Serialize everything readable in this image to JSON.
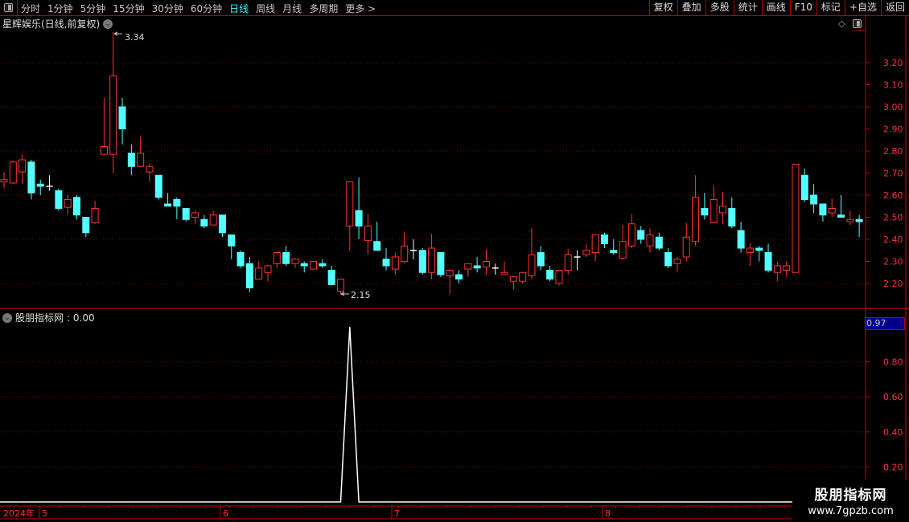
{
  "toolbar": {
    "periods": [
      "分时",
      "1分钟",
      "5分钟",
      "15分钟",
      "30分钟",
      "60分钟",
      "日线",
      "周线",
      "月线",
      "多周期",
      "更多 >"
    ],
    "active_period": "日线",
    "tools": [
      "复权",
      "叠加",
      "多股",
      "统计",
      "画线",
      "F10",
      "标记",
      "+自选",
      "返回"
    ]
  },
  "main": {
    "title": "星辉娱乐(日线,前复权)",
    "high_label": "3.34",
    "low_label": "2.15"
  },
  "indicator": {
    "title": "股朋指标网",
    "value_text": ": 0.00",
    "readout": "0.97"
  },
  "date_axis": {
    "year": "2024年",
    "months": [
      "5",
      "6",
      "7",
      "8"
    ]
  },
  "watermark": {
    "line1": "股朋指标网",
    "line2": "www.7gpzb.com"
  },
  "colors": {
    "up": "#ff3333",
    "down": "#54ffff",
    "doji": "#ffffff",
    "axis": "#cc0000",
    "grid": "#8b0000",
    "active": "#33ffff"
  },
  "chart_data": [
    {
      "type": "candlestick",
      "ylim": [
        2.1,
        3.4
      ],
      "yticks": [
        "3.20",
        "3.10",
        "3.00",
        "2.90",
        "2.80",
        "2.70",
        "2.60",
        "2.50",
        "2.40",
        "2.30",
        "2.20"
      ],
      "grid": true,
      "ohlc": [
        [
          2.66,
          2.705,
          2.63,
          2.67
        ],
        [
          2.655,
          2.756,
          2.65,
          2.75
        ],
        [
          2.705,
          2.785,
          2.65,
          2.76
        ],
        [
          2.75,
          2.76,
          2.58,
          2.61
        ],
        [
          2.65,
          2.67,
          2.6,
          2.64
        ],
        [
          2.64,
          2.69,
          2.62,
          2.64
        ],
        [
          2.62,
          2.63,
          2.53,
          2.54
        ],
        [
          2.545,
          2.6,
          2.51,
          2.58
        ],
        [
          2.59,
          2.6,
          2.49,
          2.51
        ],
        [
          2.5,
          2.5,
          2.41,
          2.43
        ],
        [
          2.475,
          2.575,
          2.47,
          2.54
        ],
        [
          2.785,
          3.04,
          2.785,
          2.82
        ],
        [
          2.785,
          3.34,
          2.7,
          3.14
        ],
        [
          3.0,
          3.04,
          2.83,
          2.9
        ],
        [
          2.79,
          2.83,
          2.69,
          2.73
        ],
        [
          2.73,
          2.865,
          2.73,
          2.79
        ],
        [
          2.705,
          2.745,
          2.66,
          2.73
        ],
        [
          2.69,
          2.69,
          2.58,
          2.59
        ],
        [
          2.56,
          2.61,
          2.55,
          2.55
        ],
        [
          2.58,
          2.59,
          2.49,
          2.55
        ],
        [
          2.54,
          2.54,
          2.48,
          2.49
        ],
        [
          2.5,
          2.53,
          2.47,
          2.52
        ],
        [
          2.49,
          2.51,
          2.45,
          2.46
        ],
        [
          2.465,
          2.53,
          2.465,
          2.51
        ],
        [
          2.51,
          2.51,
          2.41,
          2.43
        ],
        [
          2.42,
          2.42,
          2.31,
          2.37
        ],
        [
          2.34,
          2.35,
          2.27,
          2.28
        ],
        [
          2.29,
          2.32,
          2.16,
          2.18
        ],
        [
          2.22,
          2.3,
          2.22,
          2.27
        ],
        [
          2.25,
          2.285,
          2.21,
          2.28
        ],
        [
          2.29,
          2.345,
          2.27,
          2.34
        ],
        [
          2.34,
          2.37,
          2.28,
          2.29
        ],
        [
          2.29,
          2.315,
          2.27,
          2.31
        ],
        [
          2.29,
          2.3,
          2.25,
          2.28
        ],
        [
          2.265,
          2.3,
          2.265,
          2.3
        ],
        [
          2.29,
          2.31,
          2.27,
          2.28
        ],
        [
          2.26,
          2.28,
          2.195,
          2.195
        ],
        [
          2.165,
          2.22,
          2.15,
          2.22
        ],
        [
          2.46,
          2.66,
          2.35,
          2.66
        ],
        [
          2.53,
          2.68,
          2.4,
          2.46
        ],
        [
          2.395,
          2.515,
          2.33,
          2.46
        ],
        [
          2.39,
          2.48,
          2.35,
          2.35
        ],
        [
          2.31,
          2.36,
          2.26,
          2.28
        ],
        [
          2.265,
          2.34,
          2.24,
          2.32
        ],
        [
          2.3,
          2.435,
          2.29,
          2.37
        ],
        [
          2.35,
          2.4,
          2.31,
          2.35
        ],
        [
          2.35,
          2.36,
          2.24,
          2.25
        ],
        [
          2.25,
          2.425,
          2.22,
          2.36
        ],
        [
          2.34,
          2.34,
          2.23,
          2.24
        ],
        [
          2.235,
          2.26,
          2.15,
          2.26
        ],
        [
          2.24,
          2.26,
          2.2,
          2.22
        ],
        [
          2.265,
          2.29,
          2.23,
          2.29
        ],
        [
          2.28,
          2.32,
          2.25,
          2.27
        ],
        [
          2.275,
          2.355,
          2.24,
          2.3
        ],
        [
          2.27,
          2.29,
          2.24,
          2.27
        ],
        [
          2.24,
          2.3,
          2.24,
          2.25
        ],
        [
          2.21,
          2.235,
          2.17,
          2.23
        ],
        [
          2.21,
          2.25,
          2.2,
          2.25
        ],
        [
          2.235,
          2.45,
          2.22,
          2.33
        ],
        [
          2.34,
          2.37,
          2.26,
          2.28
        ],
        [
          2.26,
          2.28,
          2.21,
          2.22
        ],
        [
          2.2,
          2.26,
          2.19,
          2.26
        ],
        [
          2.26,
          2.355,
          2.24,
          2.33
        ],
        [
          2.32,
          2.35,
          2.26,
          2.32
        ],
        [
          2.33,
          2.38,
          2.32,
          2.35
        ],
        [
          2.34,
          2.42,
          2.3,
          2.42
        ],
        [
          2.42,
          2.43,
          2.36,
          2.38
        ],
        [
          2.35,
          2.4,
          2.33,
          2.34
        ],
        [
          2.315,
          2.465,
          2.31,
          2.39
        ],
        [
          2.37,
          2.515,
          2.36,
          2.47
        ],
        [
          2.44,
          2.46,
          2.38,
          2.4
        ],
        [
          2.37,
          2.45,
          2.34,
          2.42
        ],
        [
          2.41,
          2.43,
          2.35,
          2.36
        ],
        [
          2.34,
          2.36,
          2.27,
          2.28
        ],
        [
          2.29,
          2.32,
          2.25,
          2.31
        ],
        [
          2.32,
          2.475,
          2.3,
          2.41
        ],
        [
          2.39,
          2.69,
          2.37,
          2.59
        ],
        [
          2.54,
          2.61,
          2.49,
          2.51
        ],
        [
          2.475,
          2.645,
          2.475,
          2.58
        ],
        [
          2.52,
          2.615,
          2.47,
          2.55
        ],
        [
          2.54,
          2.59,
          2.45,
          2.46
        ],
        [
          2.44,
          2.48,
          2.34,
          2.36
        ],
        [
          2.34,
          2.38,
          2.28,
          2.36
        ],
        [
          2.36,
          2.37,
          2.3,
          2.35
        ],
        [
          2.34,
          2.38,
          2.25,
          2.26
        ],
        [
          2.25,
          2.3,
          2.21,
          2.28
        ],
        [
          2.26,
          2.3,
          2.23,
          2.28
        ],
        [
          2.25,
          2.74,
          2.25,
          2.74
        ],
        [
          2.69,
          2.72,
          2.57,
          2.58
        ],
        [
          2.6,
          2.65,
          2.52,
          2.56
        ],
        [
          2.56,
          2.56,
          2.48,
          2.51
        ],
        [
          2.52,
          2.585,
          2.5,
          2.54
        ],
        [
          2.51,
          2.6,
          2.5,
          2.5
        ],
        [
          2.48,
          2.53,
          2.465,
          2.49
        ],
        [
          2.49,
          2.51,
          2.41,
          2.48
        ]
      ]
    },
    {
      "type": "line",
      "ylim": [
        0,
        1.0
      ],
      "yticks": [
        "0.80",
        "0.60",
        "0.40",
        "0.20"
      ],
      "grid": true,
      "spike_index": 38,
      "spike_value": 1.0,
      "baseline_value": 0.0
    }
  ]
}
